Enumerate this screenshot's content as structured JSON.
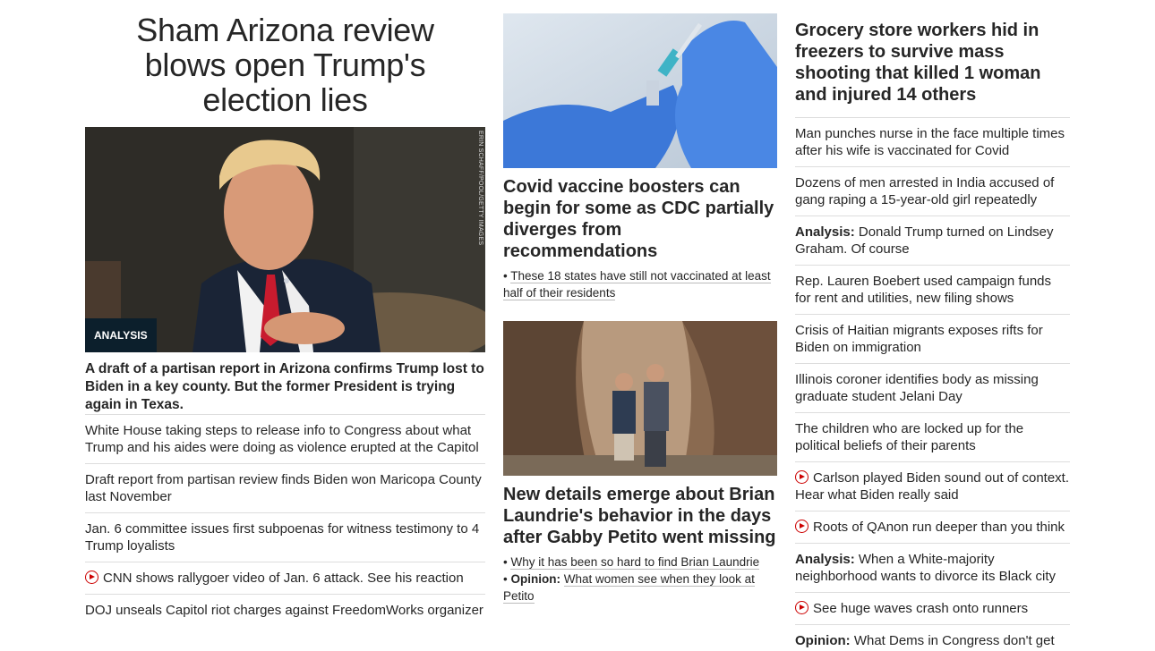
{
  "col1": {
    "title": "Sham Arizona review blows open Trump's election lies",
    "credit": "ERIN SCHAFF/POOL/GETTY IMAGES",
    "badge": "ANALYSIS",
    "description": "A draft of a partisan report in Arizona confirms Trump lost to Biden in a key county. But the former President is trying again in Texas.",
    "items": [
      {
        "text": "White House taking steps to release info to Congress about what Trump and his aides were doing as violence erupted at the Capitol"
      },
      {
        "text": "Draft report from partisan review finds Biden won Maricopa County last November"
      },
      {
        "text": "Jan. 6 committee issues first subpoenas for witness testimony to 4 Trump loyalists"
      },
      {
        "text": "CNN shows rallygoer video of Jan. 6 attack. See his reaction",
        "video": true
      },
      {
        "text": "DOJ unseals Capitol riot charges against FreedomWorks organizer"
      }
    ]
  },
  "col2": {
    "card1": {
      "title": "Covid vaccine boosters can begin for some as CDC partially diverges from recommendations",
      "bullets": [
        {
          "prefix": "",
          "text": "These 18 states have still not vaccinated at least half of their residents"
        }
      ]
    },
    "card2": {
      "title": "New details emerge about Brian Laundrie's behavior in the days after Gabby Petito went missing",
      "bullets": [
        {
          "prefix": "",
          "text": "Why it has been so hard to find Brian Laundrie"
        },
        {
          "prefix": "Opinion:",
          "text": "What women see when they look at Petito"
        }
      ]
    }
  },
  "col3": {
    "headline": "Grocery store workers hid in freezers to survive mass shooting that killed 1 woman and injured 14 others",
    "items": [
      {
        "prefix": "",
        "text": "Man punches nurse in the face multiple times after his wife is vaccinated for Covid"
      },
      {
        "prefix": "",
        "text": "Dozens of men arrested in India accused of gang raping a 15-year-old girl repeatedly"
      },
      {
        "prefix": "Analysis:",
        "text": "Donald Trump turned on Lindsey Graham. Of course"
      },
      {
        "prefix": "",
        "text": "Rep. Lauren Boebert used campaign funds for rent and utilities, new filing shows"
      },
      {
        "prefix": "",
        "text": "Crisis of Haitian migrants exposes rifts for Biden on immigration"
      },
      {
        "prefix": "",
        "text": "Illinois coroner identifies body as missing graduate student Jelani Day"
      },
      {
        "prefix": "",
        "text": "The children who are locked up for the political beliefs of their parents"
      },
      {
        "prefix": "",
        "text": "Carlson played Biden sound out of context. Hear what Biden really said",
        "video": true
      },
      {
        "prefix": "",
        "text": "Roots of QAnon run deeper than you think",
        "video": true
      },
      {
        "prefix": "Analysis:",
        "text": "When a White-majority neighborhood wants to divorce its Black city"
      },
      {
        "prefix": "",
        "text": "See huge waves crash onto runners",
        "video": true
      },
      {
        "prefix": "Opinion:",
        "text": "What Dems in Congress don't get"
      }
    ]
  },
  "colors": {
    "video_icon": "#cc0000",
    "badge_bg": "#0c1f2c",
    "divider": "#dddddd"
  }
}
